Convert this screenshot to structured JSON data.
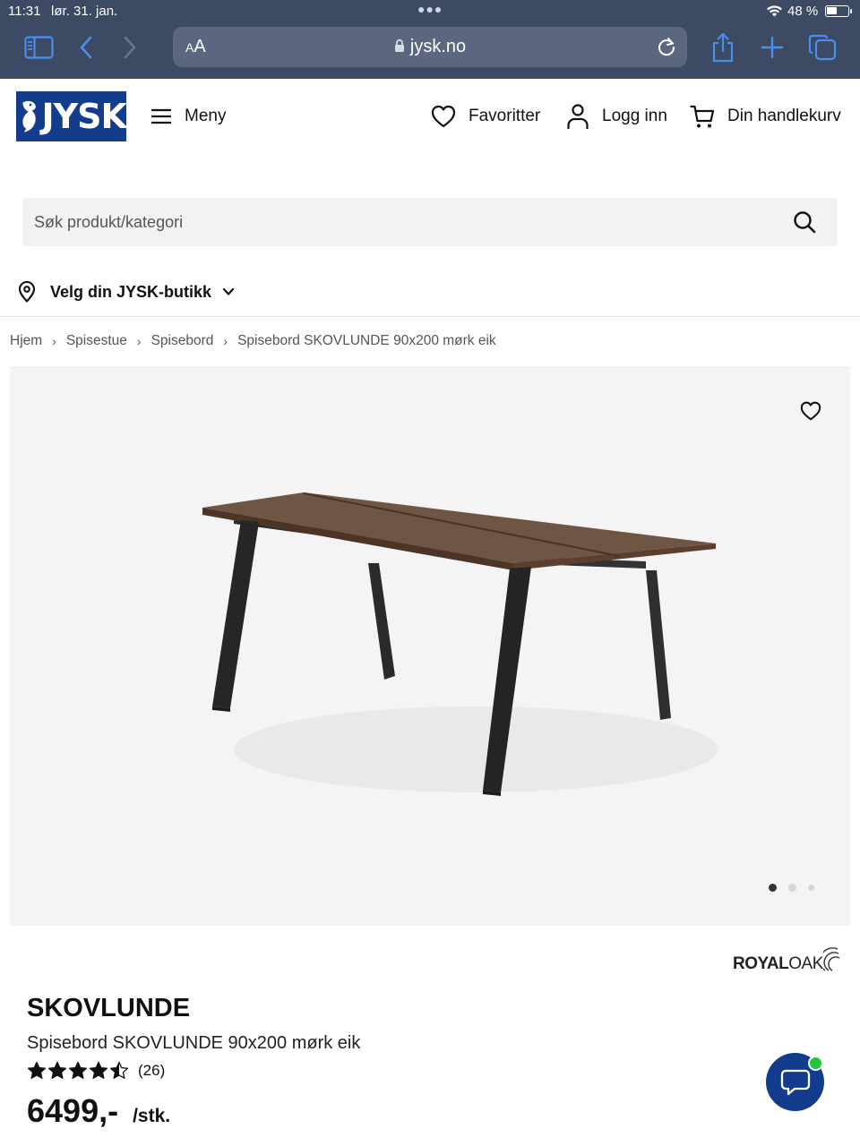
{
  "status_bar": {
    "time": "11:31",
    "date": "lør. 31. jan.",
    "battery": "48 %",
    "battery_level": 0.48
  },
  "browser": {
    "text_size_label_small": "A",
    "text_size_label_large": "A",
    "url": "jysk.no",
    "icons": [
      "sidebar-icon",
      "back-icon",
      "forward-icon",
      "lock-icon",
      "reload-icon",
      "share-icon",
      "new-tab-icon",
      "tabs-icon"
    ]
  },
  "header": {
    "logo_text": "JYSK",
    "menu_label": "Meny",
    "favorites_label": "Favoritter",
    "login_label": "Logg inn",
    "cart_label": "Din handlekurv"
  },
  "search": {
    "placeholder": "Søk produkt/kategori",
    "value": ""
  },
  "store_selector": {
    "label": "Velg din JYSK-butikk"
  },
  "breadcrumb": {
    "items": [
      "Hjem",
      "Spisestue",
      "Spisebord",
      "Spisebord SKOVLUNDE 90x200 mørk eik"
    ],
    "separator": "›"
  },
  "gallery": {
    "image_count": 3,
    "active_index": 0
  },
  "brand": {
    "part1": "ROYAL",
    "part2": "OAK"
  },
  "product": {
    "name": "SKOVLUNDE",
    "description": "Spisebord SKOVLUNDE 90x200 mørk eik",
    "rating_value": 4.5,
    "rating_max": 5,
    "review_count": "(26)",
    "price": "6499,-",
    "unit": "/stk."
  },
  "colors": {
    "brand_blue": "#143c8c",
    "safari_bar": "#3d4a63",
    "online_green": "#25c43a"
  }
}
